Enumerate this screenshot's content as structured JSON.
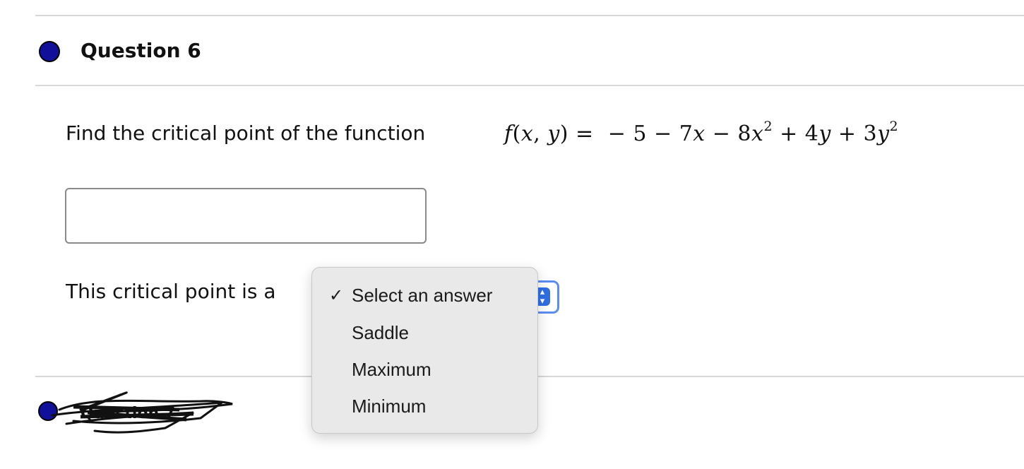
{
  "question": {
    "title": "Question 6",
    "prompt": "Find the critical point of the function",
    "function": {
      "lhs": "f(x, y) =",
      "rhs": "− 5 − 7x − 8x² + 4y + 3y²"
    },
    "answer_value": "",
    "classification_label": "This critical point is a"
  },
  "dropdown": {
    "selected": "Select an answer",
    "options": [
      "Select an answer",
      "Saddle",
      "Maximum",
      "Minimum"
    ]
  },
  "next_question": {
    "title": "Question 7"
  },
  "colors": {
    "bullet": "#10109a",
    "select_accent": "#2f6fe4",
    "menu_bg": "#e9e9ea",
    "divider": "#d8d8d8"
  }
}
